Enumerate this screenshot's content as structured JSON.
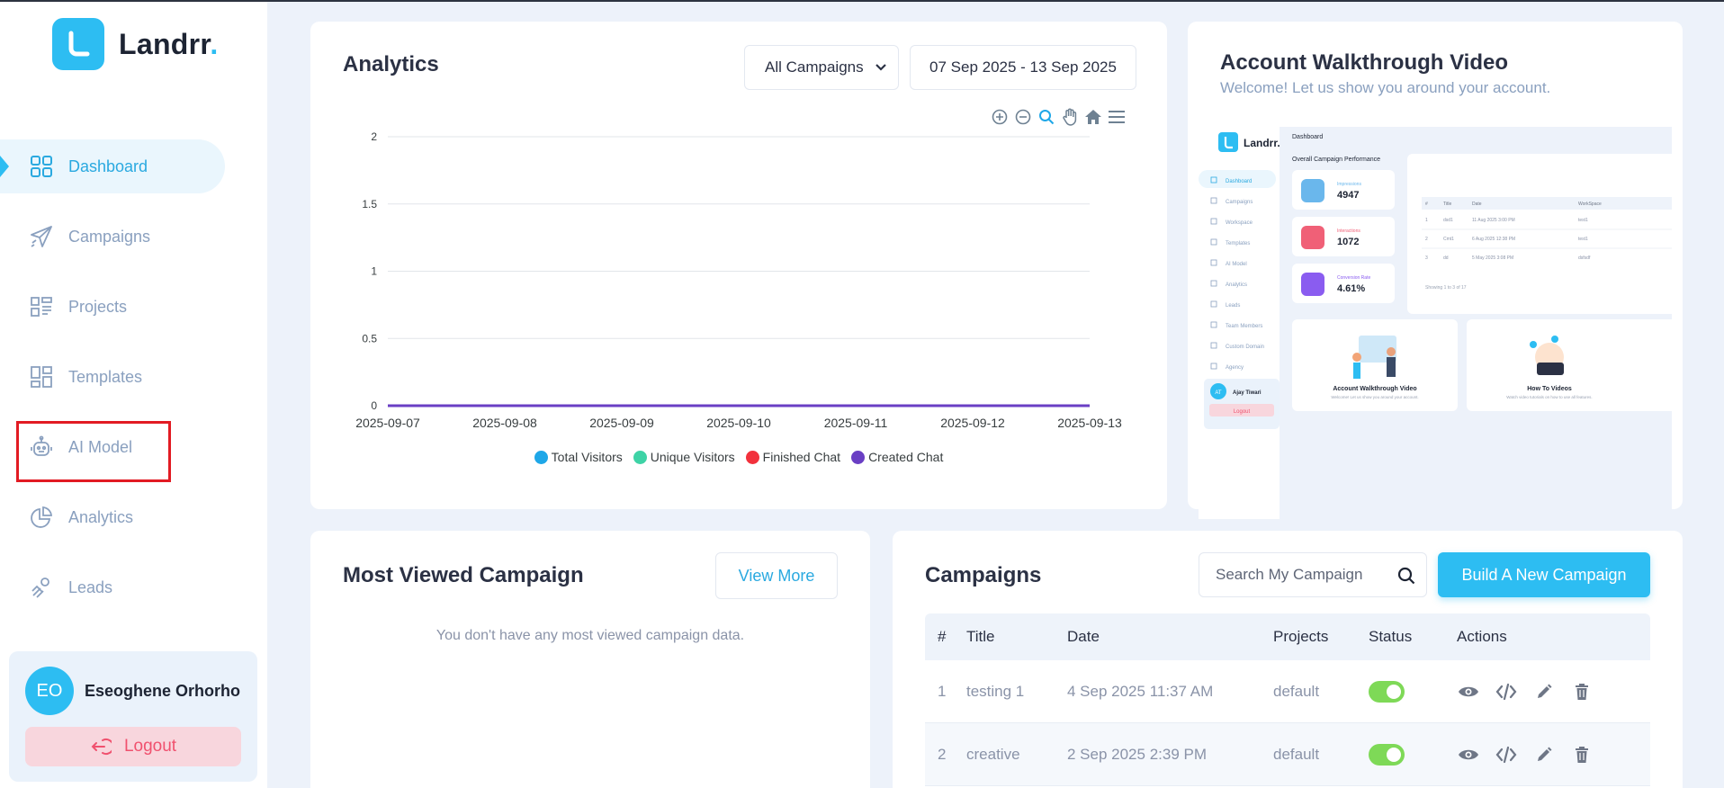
{
  "brand": {
    "name": "Landrr",
    "dot": "."
  },
  "sidebar": {
    "items": [
      {
        "label": "Dashboard",
        "icon": "grid-icon"
      },
      {
        "label": "Campaigns",
        "icon": "paper-plane-icon"
      },
      {
        "label": "Projects",
        "icon": "projects-icon"
      },
      {
        "label": "Templates",
        "icon": "templates-icon"
      },
      {
        "label": "AI Model",
        "icon": "robot-icon"
      },
      {
        "label": "Analytics",
        "icon": "pie-chart-icon"
      },
      {
        "label": "Leads",
        "icon": "leads-icon"
      }
    ],
    "active": "Dashboard"
  },
  "user": {
    "initials": "EO",
    "name": "Eseoghene Orhorho",
    "logout_label": "Logout"
  },
  "analytics": {
    "title": "Analytics",
    "campaign_filter": "All Campaigns",
    "date_range": "07 Sep 2025 - 13 Sep 2025"
  },
  "chart_data": {
    "type": "line",
    "x": [
      "2025-09-07",
      "2025-09-08",
      "2025-09-09",
      "2025-09-10",
      "2025-09-11",
      "2025-09-12",
      "2025-09-13"
    ],
    "yticks": [
      "0",
      "0.5",
      "1",
      "1.5",
      "2"
    ],
    "ylim": [
      0,
      2
    ],
    "grid": true,
    "legend_position": "bottom",
    "series": [
      {
        "name": "Total Visitors",
        "color": "#1ea7e8",
        "values": [
          0,
          0,
          0,
          0,
          0,
          0,
          0
        ]
      },
      {
        "name": "Unique Visitors",
        "color": "#3ed3a6",
        "values": [
          0,
          0,
          0,
          0,
          0,
          0,
          0
        ]
      },
      {
        "name": "Finished Chat",
        "color": "#f2313c",
        "values": [
          0,
          0,
          0,
          0,
          0,
          0,
          0
        ]
      },
      {
        "name": "Created Chat",
        "color": "#6a3fc4",
        "values": [
          0,
          0,
          0,
          0,
          0,
          0,
          0
        ]
      }
    ]
  },
  "walkthrough": {
    "title": "Account Walkthrough Video",
    "subtitle": "Welcome! Let us show you around your account.",
    "preview": {
      "brand": "Landrr.",
      "header": "Dashboard",
      "section": "Overall Campaign Performance",
      "nav": [
        "Dashboard",
        "Campaigns",
        "Workspace",
        "Templates",
        "AI Model",
        "Analytics",
        "Leads",
        "Team Members",
        "Custom Domain",
        "Agency"
      ],
      "stats": [
        {
          "label": "Impressions",
          "value": "4947",
          "color": "#6ab7ec"
        },
        {
          "label": "Interactions",
          "value": "1072",
          "color": "#f06077"
        },
        {
          "label": "Conversion Rate",
          "value": "4.61%",
          "color": "#8a5cf0"
        }
      ],
      "table_head": [
        "#",
        "Title",
        "Date",
        "WorkSpace"
      ],
      "table_rows": [
        [
          "1",
          "dsd1",
          "11 Aug 2025 3:00 PM",
          "test1"
        ],
        [
          "2",
          "Cmt1",
          "6 Aug 2025 12:38 PM",
          "test1"
        ],
        [
          "3",
          "dd",
          "5 May 2025 3:08 PM",
          "dsfsdf"
        ]
      ],
      "table_footer": "Showing 1 to 3 of 17",
      "user": {
        "initials": "AT",
        "name": "Ajay Tiwari",
        "logout": "Logout"
      },
      "video_cards": [
        {
          "title": "Account Walkthrough Video",
          "sub": "Welcome! Let us show you around your account."
        },
        {
          "title": "How To Videos",
          "sub": "Watch video tutorials on how to use all features."
        }
      ]
    }
  },
  "most_viewed": {
    "title": "Most Viewed Campaign",
    "view_more_label": "View More",
    "empty_message": "You don't have any most viewed campaign data."
  },
  "campaigns": {
    "title": "Campaigns",
    "search_placeholder": "Search My Campaign",
    "build_label": "Build A New Campaign",
    "columns": [
      "#",
      "Title",
      "Date",
      "Projects",
      "Status",
      "Actions"
    ],
    "rows": [
      {
        "num": "1",
        "title": "testing 1",
        "date": "4 Sep 2025 11:37 AM",
        "project": "default",
        "status_on": true
      },
      {
        "num": "2",
        "title": "creative",
        "date": "2 Sep 2025 2:39 PM",
        "project": "default",
        "status_on": true
      }
    ]
  }
}
